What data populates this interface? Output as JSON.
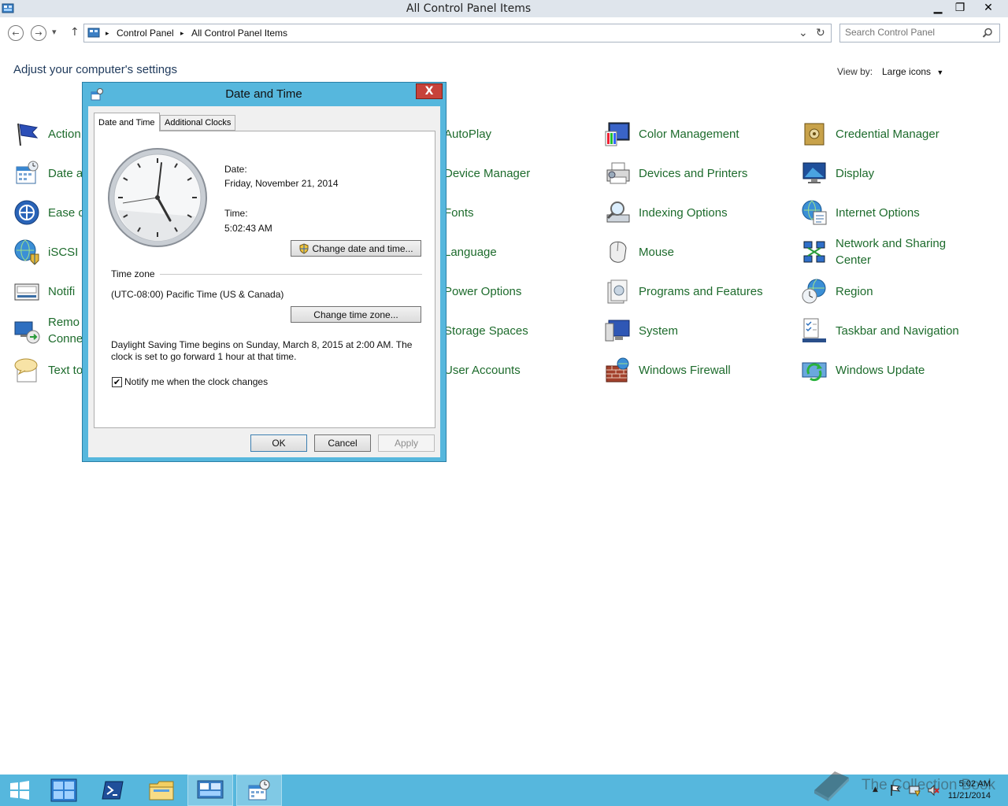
{
  "window": {
    "title": "All Control Panel Items",
    "minimize_glyph": "▁",
    "restore_glyph": "❐",
    "close_glyph": "✕"
  },
  "navigation": {
    "back_glyph": "←",
    "forward_glyph": "→",
    "recent_glyph": "▾",
    "up_glyph": "↑"
  },
  "breadcrumb": {
    "items": [
      "Control Panel",
      "All Control Panel Items"
    ],
    "separator_glyph": "▸",
    "dropdown_glyph": "⌄",
    "refresh_glyph": "↻"
  },
  "search": {
    "placeholder": "Search Control Panel",
    "icon": "magnifier-icon"
  },
  "page": {
    "heading": "Adjust your computer's settings",
    "view_by_label": "View by:",
    "view_by_value": "Large icons",
    "view_by_arrow": "▼"
  },
  "items": [
    {
      "label": "Action Center",
      "visible": "Action",
      "icon": "flag-icon"
    },
    {
      "label": "Date and Time",
      "visible": "Date a",
      "icon": "calendar-clock-icon"
    },
    {
      "label": "Ease of Access Center",
      "visible": "Ease o",
      "icon": "ease-of-access-icon"
    },
    {
      "label": "iSCSI Initiator",
      "visible": "iSCSI I",
      "icon": "globe-shield-icon"
    },
    {
      "label": "Notification Area Icons",
      "visible": "Notifi",
      "icon": "notification-tray-icon"
    },
    {
      "label": "RemoteApp and Desktop Connections",
      "visible1": "Remo",
      "visible2": "Conne",
      "icon": "remote-desktop-icon"
    },
    {
      "label": "Text to Speech",
      "visible": "Text to",
      "icon": "speech-bubble-icon"
    },
    {
      "label": "AutoPlay",
      "visible": "AutoPlay"
    },
    {
      "label": "Device Manager",
      "visible": "Device Manager"
    },
    {
      "label": "Fonts",
      "visible": "Fonts"
    },
    {
      "label": "Language",
      "visible": "Language"
    },
    {
      "label": "Power Options",
      "visible": "Power Options"
    },
    {
      "label": "Storage Spaces",
      "visible": "Storage Spaces"
    },
    {
      "label": "User Accounts",
      "visible": "User Accounts"
    },
    {
      "label": "Color Management",
      "icon": "color-monitor-icon"
    },
    {
      "label": "Devices and Printers",
      "icon": "printer-icon"
    },
    {
      "label": "Indexing Options",
      "icon": "magnifier-drive-icon"
    },
    {
      "label": "Mouse",
      "icon": "mouse-icon"
    },
    {
      "label": "Programs and Features",
      "icon": "programs-box-icon"
    },
    {
      "label": "System",
      "icon": "system-monitor-icon"
    },
    {
      "label": "Windows Firewall",
      "icon": "brick-wall-icon"
    },
    {
      "label": "Credential Manager",
      "icon": "vault-icon"
    },
    {
      "label": "Display",
      "icon": "display-monitor-icon"
    },
    {
      "label": "Internet Options",
      "icon": "globe-doc-icon"
    },
    {
      "label": "Network and Sharing Center",
      "line1": "Network and Sharing",
      "line2": "Center",
      "icon": "network-icon"
    },
    {
      "label": "Region",
      "icon": "globe-clock-icon"
    },
    {
      "label": "Taskbar and Navigation",
      "icon": "taskbar-checklist-icon"
    },
    {
      "label": "Windows Update",
      "icon": "update-arrows-icon"
    }
  ],
  "dialog": {
    "title": "Date and Time",
    "close_glyph": "X",
    "tabs": [
      "Date and Time",
      "Additional Clocks"
    ],
    "date_label": "Date:",
    "date_value": "Friday, November 21, 2014",
    "time_label": "Time:",
    "time_value": "5:02:43 AM",
    "change_datetime_button": "Change date and time...",
    "timezone_heading": "Time zone",
    "timezone_value": "(UTC-08:00) Pacific Time (US & Canada)",
    "change_timezone_button": "Change time zone...",
    "dst_line1": "Daylight Saving Time begins on Sunday, March 8, 2015 at 2:00 AM. The",
    "dst_line2": "clock is set to go forward 1 hour at that time.",
    "notify_label": "Notify me when the clock changes",
    "notify_checked": true,
    "check_glyph": "✔",
    "ok": "OK",
    "cancel": "Cancel",
    "apply": "Apply"
  },
  "taskbar": {
    "time": "5:02 AM",
    "date": "11/21/2014",
    "tray_up_glyph": "▲",
    "watermark_text": "The Collection Book",
    "colors": {
      "taskbar": "#56b7dd",
      "link": "#1d6b2c"
    }
  }
}
